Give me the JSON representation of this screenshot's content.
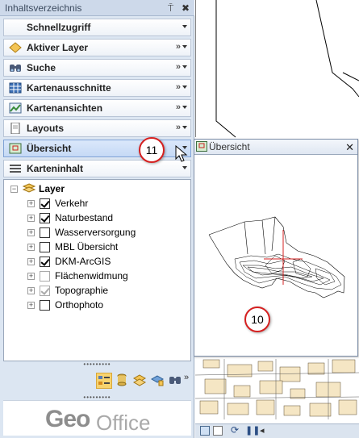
{
  "panel": {
    "title": "Inhaltsverzeichnis",
    "pin_glyph": "⍑",
    "close_glyph": "✖"
  },
  "sections": [
    {
      "label": "Schnellzugriff",
      "icon": "none",
      "chevrons": ""
    },
    {
      "label": "Aktiver Layer",
      "icon": "diamond-layer-icon",
      "chevrons": "»"
    },
    {
      "label": "Suche",
      "icon": "binoculars-icon",
      "chevrons": "»"
    },
    {
      "label": "Kartenausschnitte",
      "icon": "bookmark-grid-icon",
      "chevrons": "»"
    },
    {
      "label": "Kartenansichten",
      "icon": "map-views-icon",
      "chevrons": "»"
    },
    {
      "label": "Layouts",
      "icon": "layout-page-icon",
      "chevrons": "»"
    },
    {
      "label": "Übersicht",
      "icon": "overview-map-icon",
      "chevrons": ""
    },
    {
      "label": "Karteninhalt",
      "icon": "table-of-contents-icon",
      "chevrons": ""
    }
  ],
  "layers": {
    "group_label": "Layer",
    "items": [
      {
        "label": "Verkehr",
        "checked": true,
        "dim": false
      },
      {
        "label": "Naturbestand",
        "checked": true,
        "dim": false
      },
      {
        "label": "Wasserversorgung",
        "checked": false,
        "dim": false
      },
      {
        "label": "MBL Übersicht",
        "checked": false,
        "dim": false
      },
      {
        "label": "DKM-ArcGIS",
        "checked": true,
        "dim": false
      },
      {
        "label": "Flächenwidmung",
        "checked": false,
        "dim": true
      },
      {
        "label": "Topographie",
        "checked": true,
        "dim": true
      },
      {
        "label": "Orthophoto",
        "checked": false,
        "dim": false
      }
    ]
  },
  "splitter_glyph": "•••••••••",
  "logo": {
    "part1": "Geo",
    "part2": "Office"
  },
  "overview_window": {
    "title": "Übersicht",
    "close_glyph": "✕"
  },
  "callouts": [
    {
      "text": "11"
    },
    {
      "text": "10"
    }
  ],
  "colors": {
    "accent": "#7fa2d6",
    "callout_border": "#d62020"
  }
}
